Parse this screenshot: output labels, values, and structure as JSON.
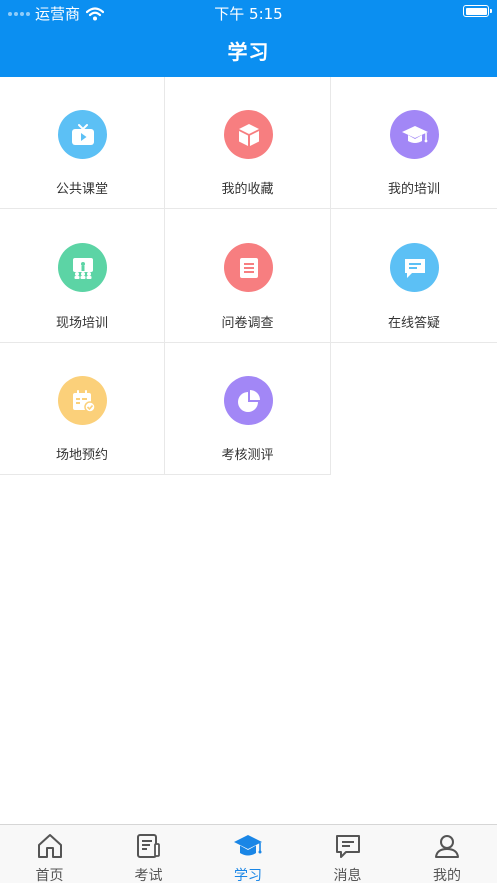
{
  "status": {
    "carrier": "运营商",
    "time": "下午 5:15"
  },
  "header": {
    "title": "学习"
  },
  "grid": {
    "items": [
      {
        "label": "公共课堂",
        "icon": "tv-icon",
        "color": "#5cc0f5"
      },
      {
        "label": "我的收藏",
        "icon": "box-icon",
        "color": "#f77e80"
      },
      {
        "label": "我的培训",
        "icon": "graduation-cap-icon",
        "color": "#a287f6"
      },
      {
        "label": "现场培训",
        "icon": "presentation-icon",
        "color": "#5cd4a5"
      },
      {
        "label": "问卷调查",
        "icon": "document-icon",
        "color": "#f77e80"
      },
      {
        "label": "在线答疑",
        "icon": "chat-bubble-icon",
        "color": "#5cc0f5"
      },
      {
        "label": "场地预约",
        "icon": "calendar-check-icon",
        "color": "#fbd07a"
      },
      {
        "label": "考核测评",
        "icon": "pie-chart-icon",
        "color": "#a287f6"
      }
    ]
  },
  "tabbar": {
    "active": "学习",
    "active_color": "#1a86e6",
    "tabs": [
      {
        "label": "首页",
        "icon": "home-icon"
      },
      {
        "label": "考试",
        "icon": "exam-paper-icon"
      },
      {
        "label": "学习",
        "icon": "graduation-cap-icon"
      },
      {
        "label": "消息",
        "icon": "message-icon"
      },
      {
        "label": "我的",
        "icon": "user-icon"
      }
    ]
  }
}
